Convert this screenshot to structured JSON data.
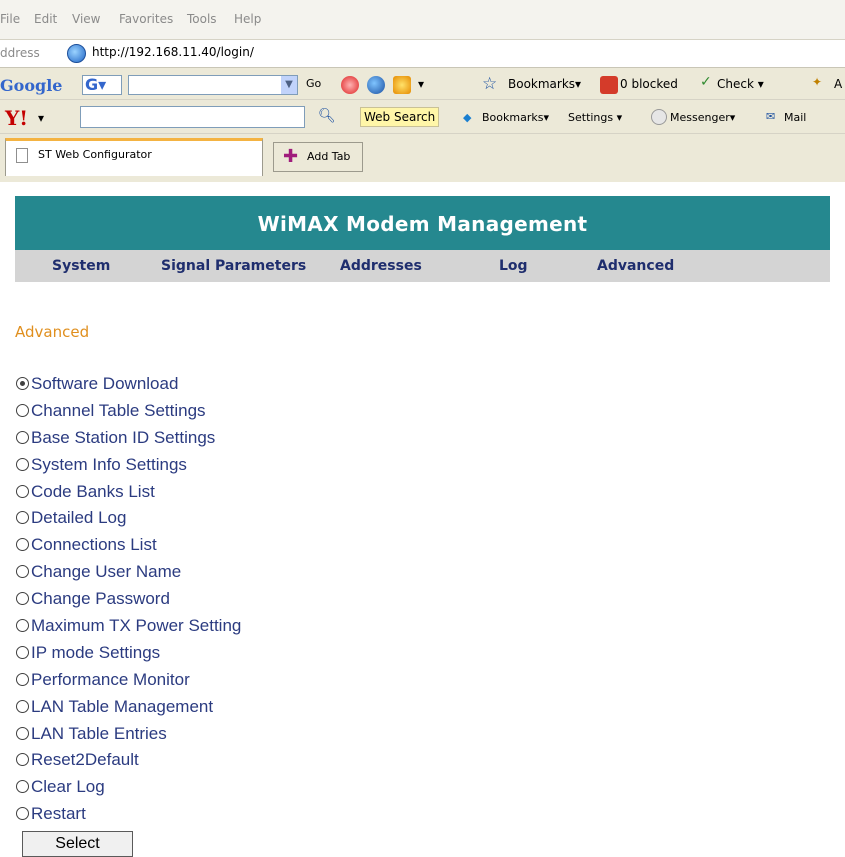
{
  "browser": {
    "menu": [
      "File",
      "Edit",
      "View",
      "Favorites",
      "Tools",
      "Help"
    ],
    "address_label": "ddress",
    "url": "http://192.168.11.40/login/",
    "google_toolbar": {
      "logo": "Google",
      "g_button": "G▾",
      "go": "Go",
      "bookmarks": "Bookmarks▾",
      "blocked": "0 blocked",
      "check": "Check ▾",
      "trailing": "A"
    },
    "yahoo_toolbar": {
      "logo": "Y!",
      "web_search": "Web Search",
      "bookmarks": "Bookmarks▾",
      "settings": "Settings ▾",
      "messenger": "Messenger▾",
      "mail": "Mail"
    },
    "tabs": {
      "active_tab": "ST Web Configurator",
      "add_tab": "Add Tab"
    }
  },
  "header": {
    "title": "WiMAX Modem Management"
  },
  "nav": {
    "items": [
      "System",
      "Signal Parameters",
      "Addresses",
      "Log",
      "Advanced"
    ]
  },
  "page": {
    "section_title": "Advanced",
    "options": [
      "Software Download",
      "Channel Table Settings",
      "Base Station ID Settings",
      "System Info Settings",
      "Code Banks List",
      "Detailed Log",
      "Connections List",
      "Change User Name",
      "Change Password",
      "Maximum TX Power Setting",
      "IP mode Settings",
      "Performance Monitor",
      "LAN Table Management",
      "LAN Table Entries",
      "Reset2Default",
      "Clear Log",
      "Restart"
    ],
    "selected_option": "Software Download",
    "select_button": "Select"
  },
  "colors": {
    "header_bg": "#25888f",
    "nav_bg": "#d4d4d4",
    "nav_text": "#1f2e6e",
    "section_title": "#e08f1e",
    "option_text": "#2b3b80"
  }
}
